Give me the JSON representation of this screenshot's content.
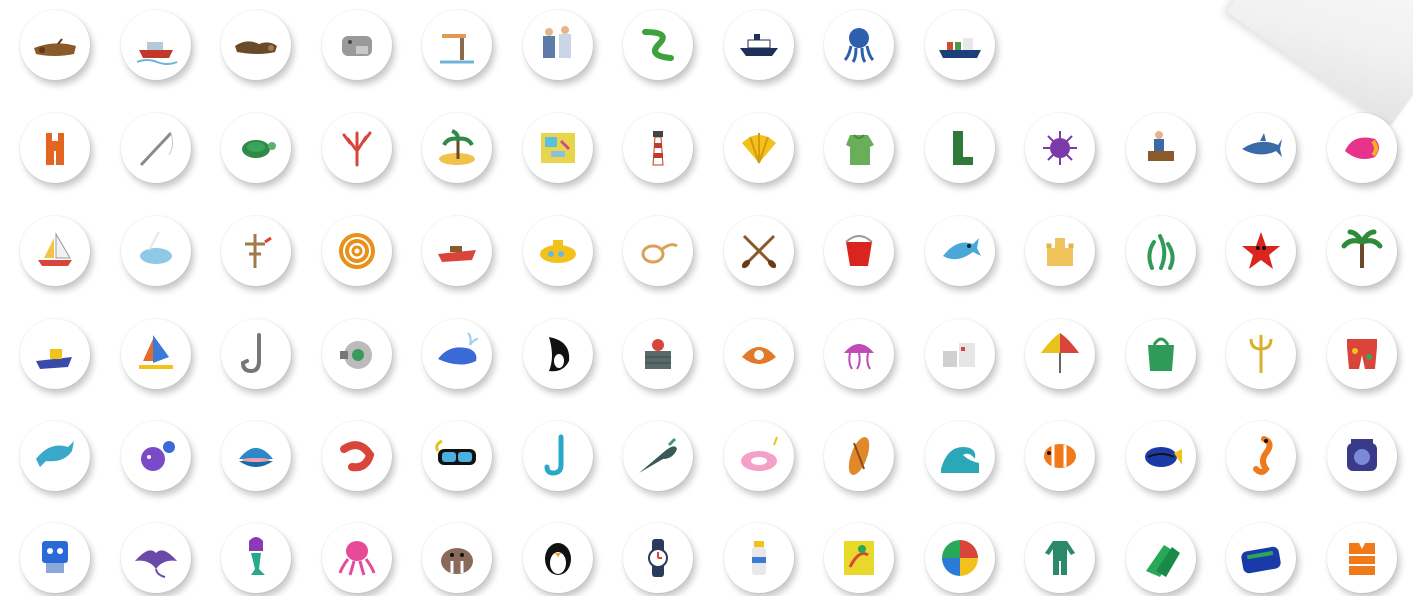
{
  "stickers": [
    [
      "driftwood-icon",
      "motorboat-icon",
      "log-icon",
      "elephant-seal-icon",
      "diving-board-icon",
      "sailors-icon",
      "eel-icon",
      "ship-icon",
      "octopus-icon",
      "cargo-ship-icon"
    ],
    [
      "overalls-icon",
      "fishing-rod-icon",
      "turtle-icon",
      "coral-icon",
      "island-icon",
      "map-icon",
      "lighthouse-icon",
      "shell-icon",
      "raincoat-icon",
      "boots-icon",
      "urchin-icon",
      "fisherman-icon",
      "shark-icon",
      "conch-icon"
    ],
    [
      "sailboat-icon",
      "narwhal-icon",
      "mast-icon",
      "rope-coil-icon",
      "speedboat-icon",
      "submarine-icon",
      "lasso-icon",
      "oars-icon",
      "bucket-icon",
      "fish-icon",
      "sandcastle-icon",
      "seaweed-icon",
      "starfish-icon",
      "palm-tree-icon"
    ],
    [
      "jet-ski-icon",
      "windsurfer-icon",
      "hook-icon",
      "reel-icon",
      "whale-icon",
      "orca-icon",
      "crab-pot-icon",
      "pearl-oyster-icon",
      "jellyfish-icon",
      "harbor-icon",
      "umbrella-icon",
      "bag-icon",
      "trident-icon",
      "shorts-icon"
    ],
    [
      "dolphin-icon",
      "pufferfish-icon",
      "clam-icon",
      "shrimp-icon",
      "goggles-icon",
      "snorkel-icon",
      "swordfish-icon",
      "unicorn-float-icon",
      "surfboard-icon",
      "wave-icon",
      "clownfish-icon",
      "tang-fish-icon",
      "seahorse-icon",
      "diving-helmet-icon"
    ],
    [
      "robot-icon",
      "manta-ray-icon",
      "mermaid-icon",
      "octopus-pink-icon",
      "walrus-icon",
      "penguin-icon",
      "watch-icon",
      "sunscreen-icon",
      "towel-icon",
      "beach-ball-icon",
      "wetsuit-icon",
      "flippers-icon",
      "air-mattress-icon",
      "life-vest-icon"
    ]
  ]
}
